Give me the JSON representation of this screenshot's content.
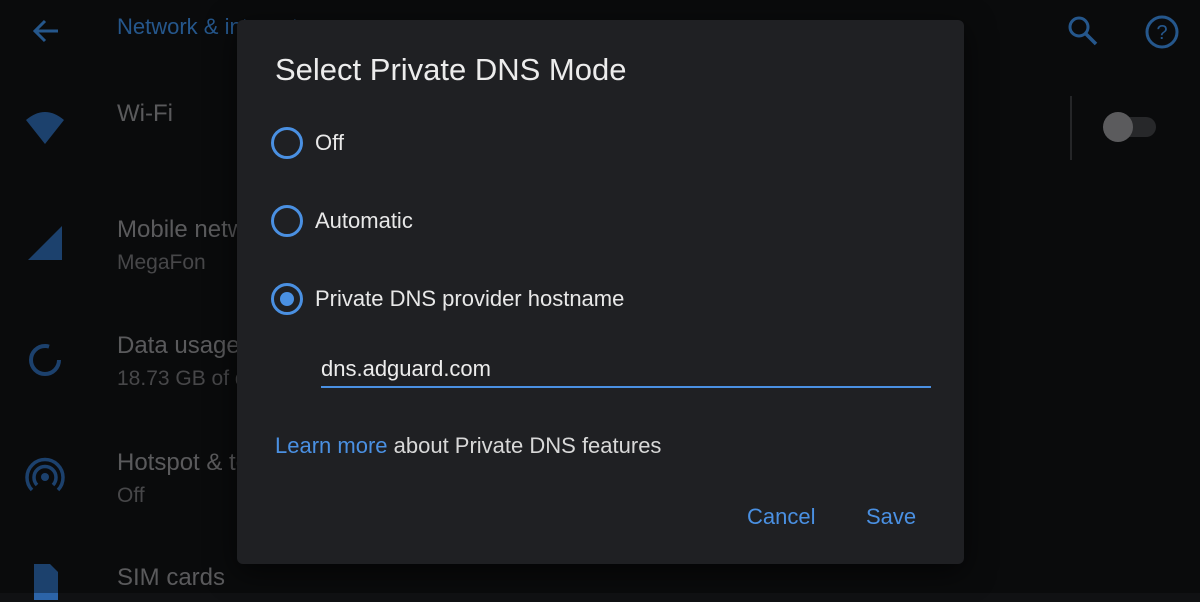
{
  "background": {
    "title": "Network & internet",
    "items": [
      {
        "title": "Wi-Fi",
        "subtitle": ""
      },
      {
        "title": "Mobile network",
        "subtitle": "MegaFon"
      },
      {
        "title": "Data usage",
        "subtitle": "18.73 GB of data used"
      },
      {
        "title": "Hotspot & tethering",
        "subtitle": "Off"
      },
      {
        "title": "SIM cards",
        "subtitle": ""
      }
    ],
    "wifi_toggle_on": false
  },
  "dialog": {
    "title": "Select Private DNS Mode",
    "options": [
      {
        "label": "Off",
        "selected": false
      },
      {
        "label": "Automatic",
        "selected": false
      },
      {
        "label": "Private DNS provider hostname",
        "selected": true
      }
    ],
    "hostname_value": "dns.adguard.com",
    "learn_more_link": "Learn more",
    "learn_more_text": " about Private DNS features",
    "cancel_label": "Cancel",
    "save_label": "Save"
  },
  "colors": {
    "accent": "#4a90e2",
    "dialog_bg": "#1f2023",
    "screen_bg": "#101113"
  },
  "icons": [
    "back-arrow-icon",
    "search-icon",
    "help-icon",
    "wifi-icon",
    "signal-icon",
    "data-usage-icon",
    "hotspot-icon",
    "sim-card-icon"
  ]
}
